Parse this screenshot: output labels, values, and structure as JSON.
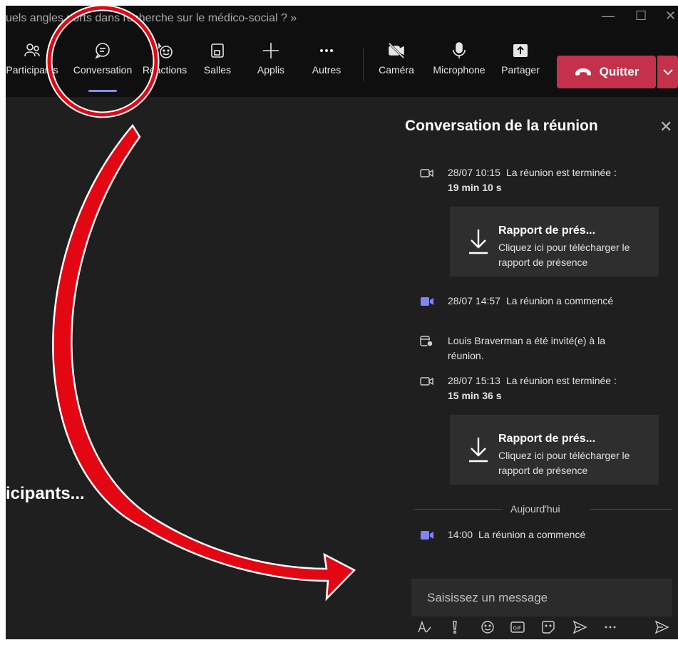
{
  "window": {
    "title": "uels angles ports dans recherche sur le médico-social ? »"
  },
  "toolbar": {
    "participants": "Participants",
    "conversation": "Conversation",
    "reactions": "Réactions",
    "rooms": "Salles",
    "apps": "Applis",
    "more": "Autres",
    "camera": "Caméra",
    "microphone": "Microphone",
    "share": "Partager",
    "leave": "Quitter"
  },
  "stage": {
    "status": "ticipants..."
  },
  "chat": {
    "title": "Conversation de la réunion",
    "messages": [
      {
        "time": "28/07 10:15",
        "text": "La réunion est terminée : ",
        "duration": "19 min 10 s"
      },
      {
        "time": "28/07 14:57",
        "text": "La réunion a commencé"
      },
      {
        "text": "Louis Braverman a été invité(e) à la réunion."
      },
      {
        "time": "28/07 15:13",
        "text": "La réunion est terminée : ",
        "duration": "15 min 36 s"
      },
      {
        "time": "14:00",
        "text": "La réunion a commencé"
      }
    ],
    "cards": [
      {
        "title": "Rapport de prés...",
        "desc": "Cliquez ici pour télécharger le rapport de présence"
      },
      {
        "title": "Rapport de prés...",
        "desc": "Cliquez ici pour télécharger le rapport de présence"
      }
    ],
    "divider": "Aujourd'hui",
    "compose_placeholder": "Saisissez un message"
  },
  "colors": {
    "accent": "#8b8cf0",
    "leave": "#c4314b",
    "annotation": "#e30613"
  }
}
